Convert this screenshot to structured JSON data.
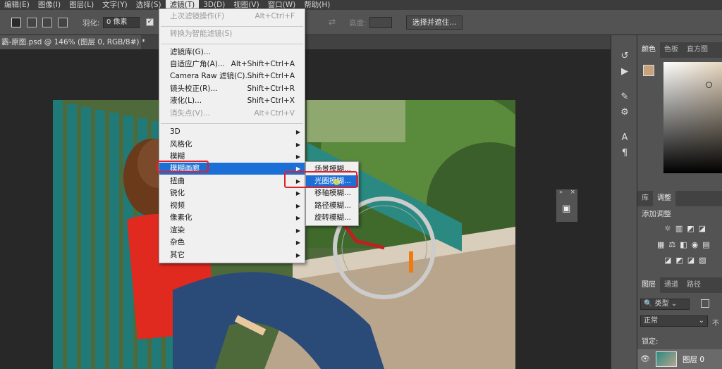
{
  "menubar": {
    "items": [
      "编辑(E)",
      "图像(I)",
      "图层(L)",
      "文字(Y)",
      "选择(S)",
      "滤镜(T)",
      "3D(D)",
      "视图(V)",
      "窗口(W)",
      "帮助(H)"
    ],
    "active": "滤镜(T)"
  },
  "options": {
    "feather_label": "羽化:",
    "feather_value": "0 像素",
    "height_label": "高度:",
    "select_mask_button": "选择并遮住..."
  },
  "document_tab": {
    "title": "霸-原图.psd @ 146% (图层 0, RGB/8#) *",
    "close": "×"
  },
  "filter_menu": {
    "items": [
      {
        "label": "上次滤镜操作(F)",
        "shortcut": "Alt+Ctrl+F",
        "disabled": true
      },
      {
        "label": "转换为智能滤镜(S)",
        "shortcut": "",
        "disabled": false
      },
      {
        "label": "滤镜库(G)...",
        "shortcut": "",
        "disabled": false
      },
      {
        "label": "自适应广角(A)...",
        "shortcut": "Alt+Shift+Ctrl+A",
        "disabled": false
      },
      {
        "label": "Camera Raw 滤镜(C)...",
        "shortcut": "Shift+Ctrl+A",
        "disabled": false
      },
      {
        "label": "镜头校正(R)...",
        "shortcut": "Shift+Ctrl+R",
        "disabled": false
      },
      {
        "label": "液化(L)...",
        "shortcut": "Shift+Ctrl+X",
        "disabled": false
      },
      {
        "label": "消失点(V)...",
        "shortcut": "Alt+Ctrl+V",
        "disabled": true
      },
      {
        "label": "3D"
      },
      {
        "label": "风格化"
      },
      {
        "label": "模糊"
      },
      {
        "label": "模糊画廊"
      },
      {
        "label": "扭曲"
      },
      {
        "label": "锐化"
      },
      {
        "label": "视频"
      },
      {
        "label": "像素化"
      },
      {
        "label": "渲染"
      },
      {
        "label": "杂色"
      },
      {
        "label": "其它"
      }
    ]
  },
  "blur_gallery_submenu": {
    "items": [
      "场景模糊...",
      "光圈模糊...",
      "移轴模糊...",
      "路径模糊...",
      "旋转模糊..."
    ],
    "highlighted": "光圈模糊..."
  },
  "panels": {
    "color_tabs": [
      "颜色",
      "色板",
      "直方图"
    ],
    "adjust_tabs": [
      "库",
      "调整"
    ],
    "add_adjustment": "添加调整",
    "layer_tabs": [
      "图层",
      "通道",
      "路径"
    ],
    "filter_kind": "类型",
    "blend_mode": "正常",
    "opacity_hint": "不",
    "lock_label": "锁定:",
    "layer_name": "图层 0"
  },
  "colors": {
    "menu_highlight": "#1c6fd6",
    "annotation_red": "#e0202a",
    "foreground_swatch": "#c8a27a"
  }
}
